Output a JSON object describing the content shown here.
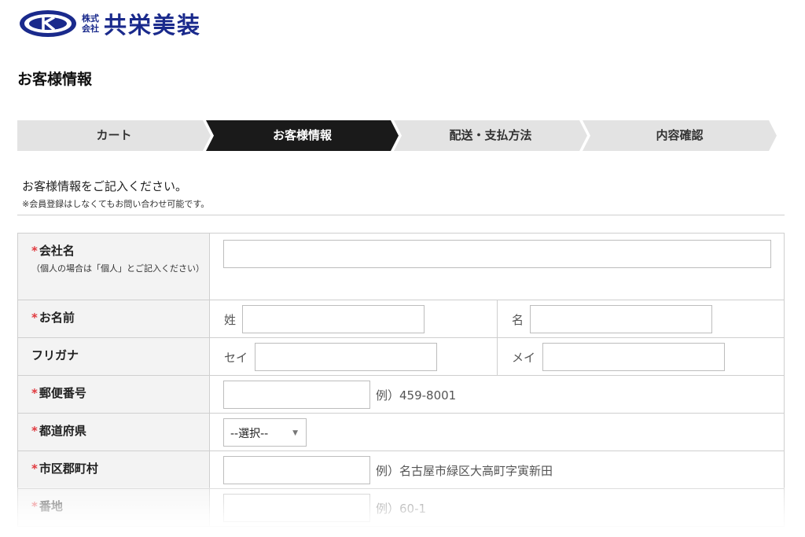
{
  "header": {
    "logo_small_top": "株式",
    "logo_small_bottom": "会社",
    "company_name": "共栄美装"
  },
  "page": {
    "title": "お客様情報"
  },
  "steps": [
    {
      "label": "カート",
      "active": false
    },
    {
      "label": "お客様情報",
      "active": true
    },
    {
      "label": "配送・支払方法",
      "active": false
    },
    {
      "label": "内容確認",
      "active": false
    }
  ],
  "intro": {
    "text": "お客様情報をご記入ください。",
    "note": "※会員登録はしなくてもお問い合わせ可能です。"
  },
  "form": {
    "required_mark": "*",
    "company": {
      "label": "会社名",
      "sub": "（個人の場合は「個人」とご記入ください）",
      "value": ""
    },
    "name": {
      "label": "お名前",
      "last_prefix": "姓",
      "first_prefix": "名",
      "last_value": "",
      "first_value": ""
    },
    "furigana": {
      "label": "フリガナ",
      "last_prefix": "セイ",
      "first_prefix": "メイ",
      "last_value": "",
      "first_value": ""
    },
    "postal": {
      "label": "郵便番号",
      "example": "例）459-8001",
      "value": ""
    },
    "prefecture": {
      "label": "都道府県",
      "selected": "--選択--"
    },
    "city": {
      "label": "市区郡町村",
      "example": "例）名古屋市緑区大高町字寅新田",
      "value": ""
    },
    "street": {
      "label": "番地",
      "example": "例）60-1",
      "value": ""
    }
  },
  "colors": {
    "brand": "#1a2a8c",
    "required": "#e0393e",
    "step_active": "#1a1a1a",
    "step_inactive": "#e3e3e3"
  }
}
